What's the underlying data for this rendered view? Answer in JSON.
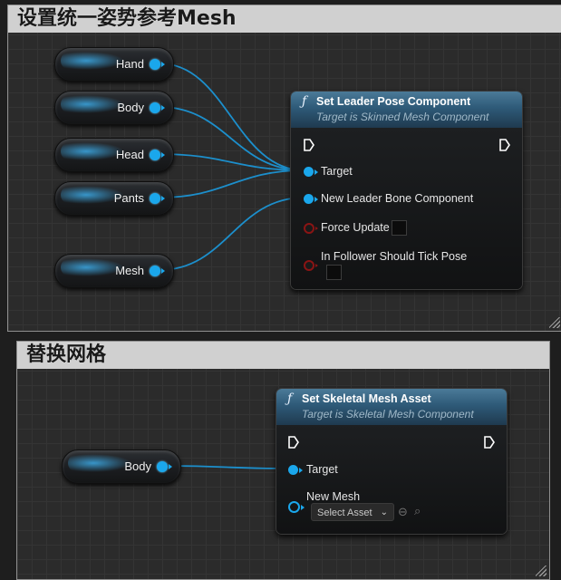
{
  "comment1": {
    "title": "设置统一姿势参考Mesh"
  },
  "comment2": {
    "title": "替换网格"
  },
  "variables1": {
    "hand": "Hand",
    "body": "Body",
    "head": "Head",
    "pants": "Pants",
    "mesh": "Mesh"
  },
  "leader_node": {
    "icon": "function-icon",
    "title": "Set Leader Pose Component",
    "subtitle": "Target is Skinned Mesh Component",
    "pins": {
      "target": "Target",
      "new_leader": "New Leader Bone Component",
      "force_update": "Force Update",
      "tick_pose": "In Follower Should Tick Pose"
    }
  },
  "variables2": {
    "body": "Body"
  },
  "skeletal_node": {
    "icon": "function-icon",
    "title": "Set Skeletal Mesh Asset",
    "subtitle": "Target is Skeletal Mesh Component",
    "pins": {
      "target": "Target",
      "new_mesh": "New Mesh",
      "select_asset": "Select Asset"
    }
  },
  "colors": {
    "object_pin": "#1aa7ec",
    "bool_pin": "#8a1414",
    "function_header": "#2e5a78",
    "comment_header": "#d0d0d0"
  }
}
